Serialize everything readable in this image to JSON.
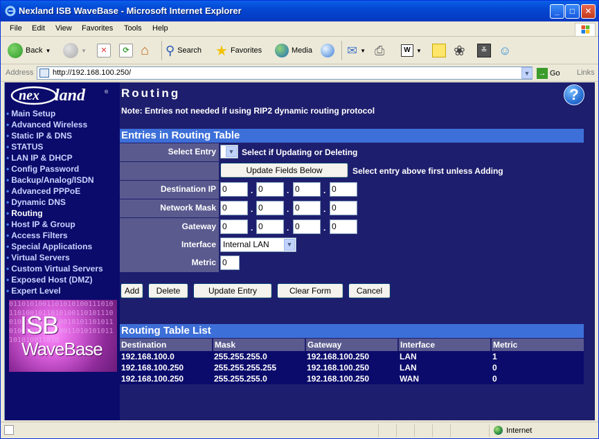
{
  "window": {
    "title": "Nexland ISB WaveBase - Microsoft Internet Explorer"
  },
  "menu": [
    "File",
    "Edit",
    "View",
    "Favorites",
    "Tools",
    "Help"
  ],
  "toolbar": {
    "back": "Back",
    "search": "Search",
    "favorites": "Favorites",
    "media": "Media"
  },
  "address": {
    "label": "Address",
    "url": "http://192.168.100.250/",
    "go": "Go",
    "links": "Links"
  },
  "sidebar": {
    "logo": "nexland",
    "items": [
      {
        "label": "Main Setup"
      },
      {
        "label": "Advanced Wireless"
      },
      {
        "label": "Static IP & DNS"
      },
      {
        "label": "STATUS"
      },
      {
        "label": "LAN IP & DHCP"
      },
      {
        "label": "Config Password"
      },
      {
        "label": "Backup/Analog/ISDN"
      },
      {
        "label": "Advanced PPPoE"
      },
      {
        "label": "Dynamic DNS"
      },
      {
        "label": "Routing"
      },
      {
        "label": "Host IP & Group"
      },
      {
        "label": "Access Filters"
      },
      {
        "label": "Special Applications"
      },
      {
        "label": "Virtual Servers"
      },
      {
        "label": "Custom Virtual Servers"
      },
      {
        "label": "Exposed Host (DMZ)"
      },
      {
        "label": "Expert Level"
      }
    ],
    "promo": {
      "line1": "ISB",
      "line2": "WaveBase"
    }
  },
  "page": {
    "title": "Routing",
    "note": "Note: Entries not needed if using RIP2 dynamic routing protocol",
    "entries_header": "Entries in Routing Table",
    "select_entry": {
      "label": "Select Entry",
      "hint": "Select if Updating or Deleting"
    },
    "update_fields": {
      "button": "Update Fields Below",
      "hint": "Select entry above first unless Adding"
    },
    "destination_ip": {
      "label": "Destination IP",
      "octets": [
        "0",
        "0",
        "0",
        "0"
      ]
    },
    "network_mask": {
      "label": "Network Mask",
      "octets": [
        "0",
        "0",
        "0",
        "0"
      ]
    },
    "gateway": {
      "label": "Gateway",
      "octets": [
        "0",
        "0",
        "0",
        "0"
      ]
    },
    "interface": {
      "label": "Interface",
      "value": "Internal LAN"
    },
    "metric": {
      "label": "Metric",
      "value": "0"
    },
    "actions": {
      "add": "Add",
      "delete": "Delete",
      "update": "Update Entry",
      "clear": "Clear Form",
      "cancel": "Cancel"
    },
    "list_header": "Routing Table List",
    "table": {
      "columns": [
        "Destination",
        "Mask",
        "Gateway",
        "Interface",
        "Metric"
      ],
      "rows": [
        [
          "192.168.100.0",
          "255.255.255.0",
          "192.168.100.250",
          "LAN",
          "1"
        ],
        [
          "192.168.100.250",
          "255.255.255.255",
          "192.168.100.250",
          "LAN",
          "0"
        ],
        [
          "192.168.100.250",
          "255.255.255.0",
          "192.168.100.250",
          "WAN",
          "0"
        ]
      ]
    }
  },
  "status": {
    "zone": "Internet"
  }
}
